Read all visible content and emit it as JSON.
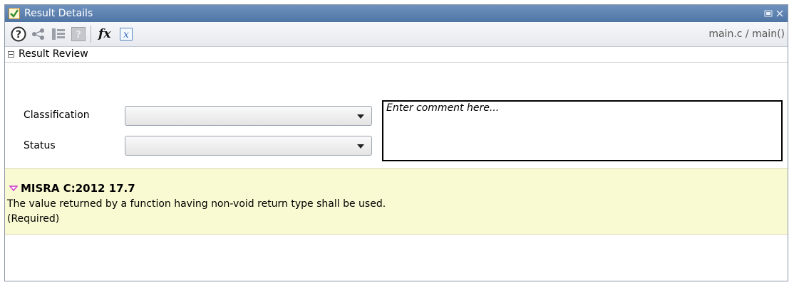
{
  "window": {
    "title": "Result Details",
    "breadcrumb": "main.c / main()"
  },
  "toolbar": {
    "icons": [
      "help-icon",
      "share-graph-icon",
      "call-tree-icon",
      "unknown-help-icon",
      "function-icon",
      "variable-icon"
    ]
  },
  "review": {
    "section_title": "Result Review",
    "classification_label": "Classification",
    "classification_value": "",
    "status_label": "Status",
    "status_value": "",
    "comment_placeholder": "Enter comment here..."
  },
  "result": {
    "rule": "MISRA C:2012 17.7",
    "description": "The value returned by a function having non-void return type shall be used.",
    "category": "(Required)"
  },
  "colors": {
    "titlebar": "#5a7fb0",
    "details_bg": "#fafad2",
    "rule_marker": "#cc33cc"
  }
}
